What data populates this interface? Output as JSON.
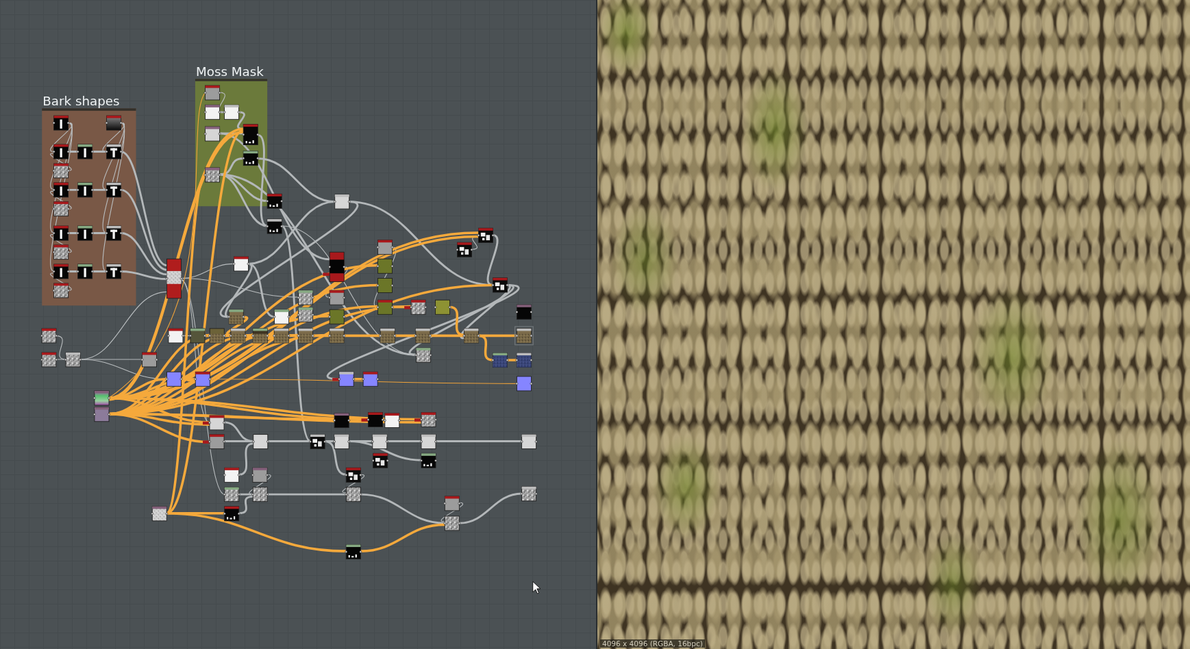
{
  "graph": {
    "frames": [
      {
        "title": "Bark shapes",
        "color": "#795846"
      },
      {
        "title": "Moss Mask",
        "color": "#6b7a3b"
      }
    ]
  },
  "viewer": {
    "info": "4096 x 4096 (RGBA, 16bpc)"
  }
}
